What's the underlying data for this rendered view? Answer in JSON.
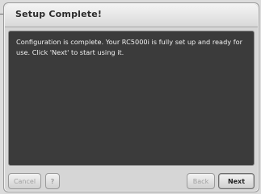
{
  "dialog": {
    "title": "Setup Complete!",
    "message": "Configuration is complete. Your RC5000i is fully set up and ready for use. Click 'Next' to start using it."
  },
  "buttons": {
    "cancel_label": "Cancel",
    "help_label": "?",
    "back_label": "Back",
    "next_label": "Next"
  }
}
